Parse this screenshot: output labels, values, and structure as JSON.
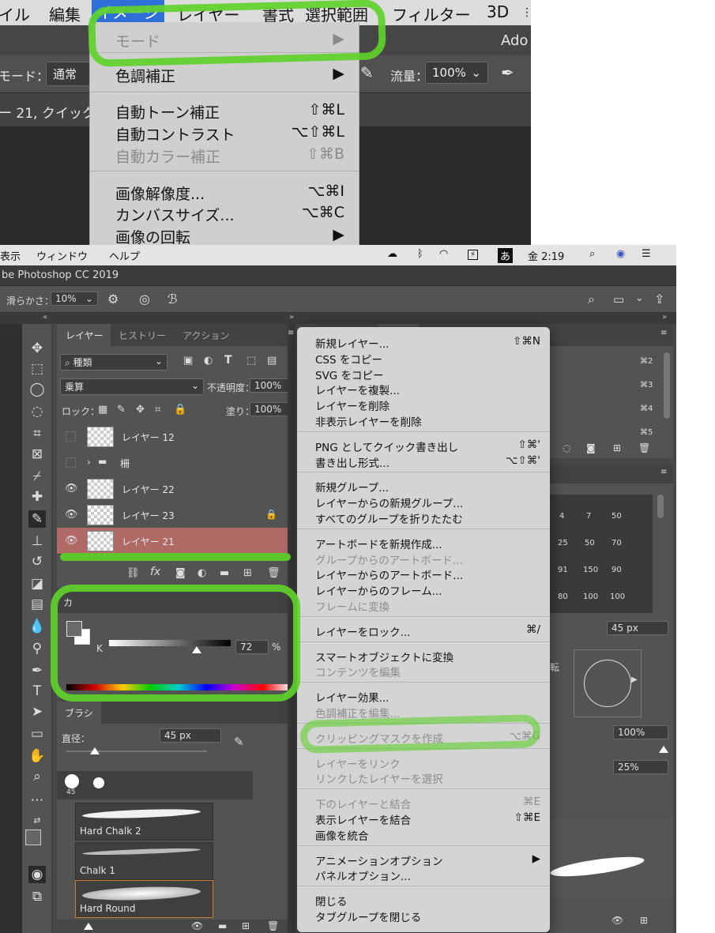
{
  "top_menubar": {
    "items": [
      "イル",
      "編集",
      "イメージ",
      "レイヤー",
      "書式",
      "選択範囲",
      "フィルター",
      "3D"
    ],
    "overflow_icon": "more-icon",
    "active_color": "#2e6fd8"
  },
  "top_app": {
    "title_fragment": "Ado",
    "mode_label": "モード：",
    "mode_value": "通常",
    "flow_label": "流量：",
    "flow_value": "100%",
    "doc_tab_fragment": "ー 21, クイック"
  },
  "image_menu": {
    "items": [
      {
        "label": "モード",
        "shortcut": "▶",
        "disabled": true
      },
      {
        "label": "色調補正",
        "shortcut": "▶",
        "disabled": false
      },
      {
        "label": "自動トーン補正",
        "shortcut": "⇧⌘L",
        "disabled": false
      },
      {
        "label": "自動コントラスト",
        "shortcut": "⌥⇧⌘L",
        "disabled": false
      },
      {
        "label": "自動カラー補正",
        "shortcut": "⇧⌘B",
        "disabled": true
      },
      {
        "label": "画像解像度...",
        "shortcut": "⌥⌘I",
        "disabled": false
      },
      {
        "label": "カンバスサイズ...",
        "shortcut": "⌥⌘C",
        "disabled": false
      },
      {
        "label": "画像の回転",
        "shortcut": "▶",
        "disabled": false
      }
    ]
  },
  "mac_menubar": {
    "items": [
      "表示",
      "ウィンドウ",
      "ヘルプ"
    ],
    "input_method": "あ",
    "clock": "金 2:19"
  },
  "app_title": "be Photoshop CC 2019",
  "options_bar": {
    "smoothing_label": "滑らかさ：",
    "smoothing_value": "10%"
  },
  "layers_panel": {
    "tabs": [
      "レイヤー",
      "ヒストリー",
      "アクション"
    ],
    "filter_value": "種類",
    "blend_mode": "乗算",
    "opacity_label": "不透明度：",
    "opacity_value": "100%",
    "lock_label": "ロック：",
    "fill_label": "塗り：",
    "fill_value": "100%",
    "layers": [
      {
        "name": "レイヤー 12",
        "visible": false,
        "locked": false,
        "selected": false,
        "group": false
      },
      {
        "name": "柵",
        "visible": false,
        "locked": false,
        "selected": false,
        "group": true
      },
      {
        "name": "レイヤー 22",
        "visible": true,
        "locked": false,
        "selected": false,
        "group": false
      },
      {
        "name": "レイヤー 23",
        "visible": true,
        "locked": true,
        "selected": false,
        "group": false
      },
      {
        "name": "レイヤー 21",
        "visible": true,
        "locked": false,
        "selected": true,
        "group": false
      }
    ],
    "footer_fx": "fx",
    "selected_color": "#b06a66"
  },
  "color_panel": {
    "tab_fragment": "カ",
    "channel": "K",
    "value": "72",
    "unit": "%",
    "slider_fraction": 0.72
  },
  "brush_panel": {
    "tab": "ブラシ",
    "size_label": "直径：",
    "size_value": "45 px",
    "tip_size": "45",
    "presets": [
      "Hard Chalk 2",
      "Chalk 1",
      "Hard Round"
    ],
    "selected_preset": "Hard Round"
  },
  "context_menu": {
    "groups": [
      [
        {
          "label": "新規レイヤー...",
          "shortcut": "⇧⌘N",
          "disabled": false
        },
        {
          "label": "CSS をコピー",
          "shortcut": "",
          "disabled": false
        },
        {
          "label": "SVG をコピー",
          "shortcut": "",
          "disabled": false
        },
        {
          "label": "レイヤーを複製...",
          "shortcut": "",
          "disabled": false
        },
        {
          "label": "レイヤーを削除",
          "shortcut": "",
          "disabled": false
        },
        {
          "label": "非表示レイヤーを削除",
          "shortcut": "",
          "disabled": false
        }
      ],
      [
        {
          "label": "PNG としてクイック書き出し",
          "shortcut": "⇧⌘'",
          "disabled": false
        },
        {
          "label": "書き出し形式...",
          "shortcut": "⌥⇧⌘'",
          "disabled": false
        }
      ],
      [
        {
          "label": "新規グループ...",
          "shortcut": "",
          "disabled": false
        },
        {
          "label": "レイヤーからの新規グループ...",
          "shortcut": "",
          "disabled": false
        },
        {
          "label": "すべてのグループを折りたたむ",
          "shortcut": "",
          "disabled": false
        }
      ],
      [
        {
          "label": "アートボードを新規作成...",
          "shortcut": "",
          "disabled": false
        },
        {
          "label": "グループからのアートボード...",
          "shortcut": "",
          "disabled": true
        },
        {
          "label": "レイヤーからのアートボード...",
          "shortcut": "",
          "disabled": false
        },
        {
          "label": "レイヤーからのフレーム...",
          "shortcut": "",
          "disabled": false
        },
        {
          "label": "フレームに変換",
          "shortcut": "",
          "disabled": true
        }
      ],
      [
        {
          "label": "レイヤーをロック...",
          "shortcut": "⌘/",
          "disabled": false
        }
      ],
      [
        {
          "label": "スマートオブジェクトに変換",
          "shortcut": "",
          "disabled": false
        },
        {
          "label": "コンテンツを編集",
          "shortcut": "",
          "disabled": true
        }
      ],
      [
        {
          "label": "レイヤー効果...",
          "shortcut": "",
          "disabled": false
        },
        {
          "label": "色調補正を編集...",
          "shortcut": "",
          "disabled": true
        }
      ],
      [
        {
          "label": "クリッピングマスクを作成",
          "shortcut": "⌥⌘G",
          "disabled": true
        }
      ],
      [
        {
          "label": "レイヤーをリンク",
          "shortcut": "",
          "disabled": true
        },
        {
          "label": "リンクしたレイヤーを選択",
          "shortcut": "",
          "disabled": true
        }
      ],
      [
        {
          "label": "下のレイヤーと結合",
          "shortcut": "⌘E",
          "disabled": true
        },
        {
          "label": "表示レイヤーを結合",
          "shortcut": "⇧⌘E",
          "disabled": false
        },
        {
          "label": "画像を統合",
          "shortcut": "",
          "disabled": false
        }
      ],
      [
        {
          "label": "アニメーションオプション",
          "shortcut": "▶",
          "disabled": false
        },
        {
          "label": "パネルオプション...",
          "shortcut": "",
          "disabled": false
        }
      ],
      [
        {
          "label": "閉じる",
          "shortcut": "",
          "disabled": false
        },
        {
          "label": "タブグループを閉じる",
          "shortcut": "",
          "disabled": false
        }
      ]
    ]
  },
  "right_panels": {
    "shortcuts": [
      "⌘2",
      "⌘3",
      "⌘4",
      "⌘5"
    ],
    "brush_sizes": [
      "4",
      "7",
      "50",
      "25",
      "50",
      "70",
      "91",
      "150",
      "90",
      "80",
      "100",
      "100"
    ],
    "size_value": "45 px",
    "angle_fragment": "転",
    "roundness_value": "100%",
    "spacing_value": "25%"
  },
  "annotation_color": "#5ed12a"
}
